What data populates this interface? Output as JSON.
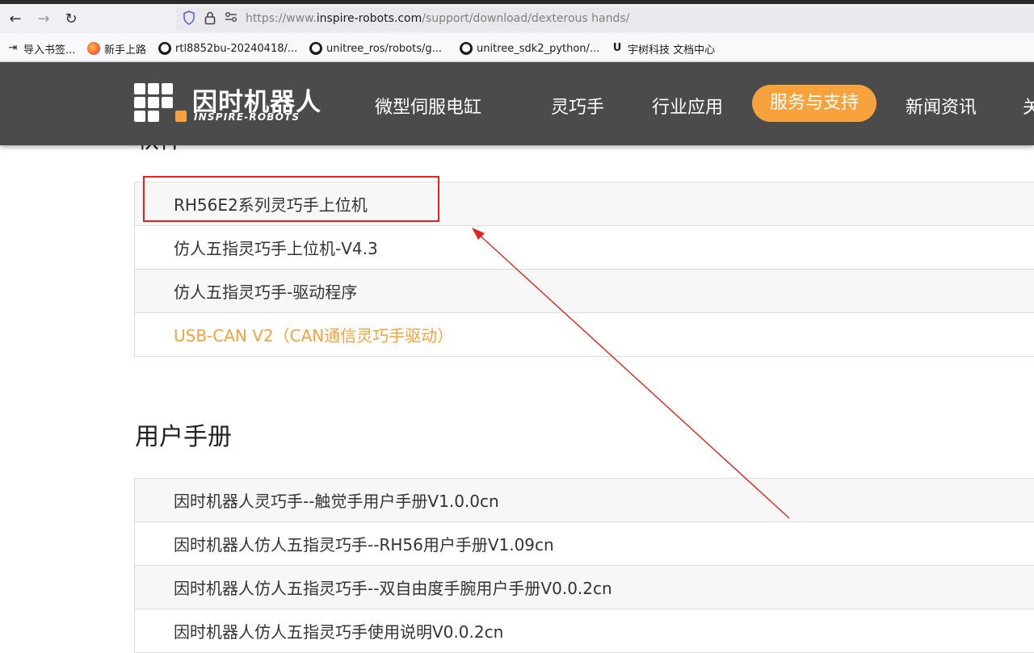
{
  "browser": {
    "url_prefix": "https://www.",
    "url_host": "inspire-robots.com",
    "url_path": "/support/download/dexterous hands/",
    "bookmarks": [
      {
        "label": "导入书签...",
        "icon": "import-icon"
      },
      {
        "label": "新手上路",
        "icon": "firefox-icon"
      },
      {
        "label": "rtl8852bu-20240418/...",
        "icon": "github-icon"
      },
      {
        "label": "unitree_ros/robots/g...",
        "icon": "github-icon"
      },
      {
        "label": "unitree_sdk2_python/...",
        "icon": "github-icon"
      },
      {
        "label": "宇树科技 文档中心",
        "icon": "unitree-icon"
      }
    ]
  },
  "header": {
    "logo_cn": "因时机器人",
    "logo_en": "INSPIRE-ROBOTS",
    "menu": [
      "微型伺服电缸",
      "灵巧手",
      "行业应用",
      "服务与支持",
      "新闻资讯",
      "关"
    ],
    "active_index": 3,
    "accent_color": "#f7a23d"
  },
  "software": {
    "title": "软件",
    "items": [
      "RH56E2系列灵巧手上位机",
      "仿人五指灵巧手上位机-V4.3",
      "仿人五指灵巧手-驱动程序",
      "USB-CAN V2（CAN通信灵巧手驱动）"
    ]
  },
  "manuals": {
    "title": "用户手册",
    "items": [
      "因时机器人灵巧手--触觉手用户手册V1.0.0cn",
      "因时机器人仿人五指灵巧手--RH56用户手册V1.09cn",
      "因时机器人仿人五指灵巧手--双自由度手腕用户手册V0.0.2cn",
      "因时机器人仿人五指灵巧手使用说明V0.0.2cn"
    ]
  },
  "annotation_color": "#e0261c"
}
